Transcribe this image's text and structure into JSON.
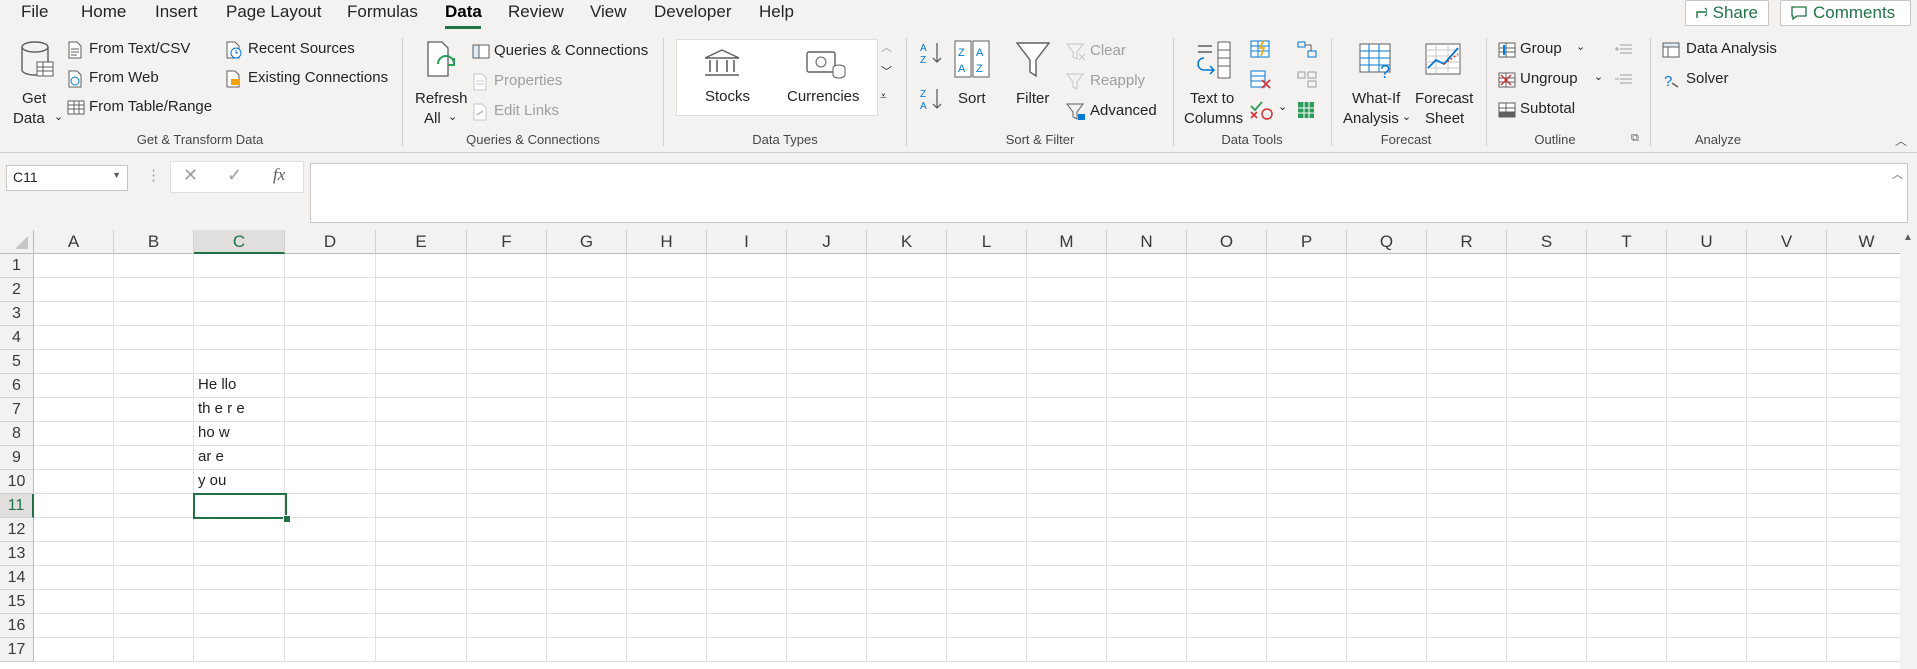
{
  "menu": {
    "items": [
      "File",
      "Home",
      "Insert",
      "Page Layout",
      "Formulas",
      "Data",
      "Review",
      "View",
      "Developer",
      "Help"
    ],
    "active": "Data",
    "share_label": "Share",
    "comments_label": "Comments"
  },
  "ribbon": {
    "get_transform": {
      "get_data_line1": "Get",
      "get_data_line2": "Data",
      "from_text_csv": "From Text/CSV",
      "from_web": "From Web",
      "from_table_range": "From Table/Range",
      "recent_sources": "Recent Sources",
      "existing_connections": "Existing Connections",
      "group_label": "Get & Transform Data"
    },
    "queries": {
      "refresh_line1": "Refresh",
      "refresh_line2": "All",
      "queries_connections": "Queries & Connections",
      "properties": "Properties",
      "edit_links": "Edit Links",
      "group_label": "Queries & Connections"
    },
    "data_types": {
      "stocks": "Stocks",
      "currencies": "Currencies",
      "group_label": "Data Types"
    },
    "sort_filter": {
      "sort": "Sort",
      "filter": "Filter",
      "clear": "Clear",
      "reapply": "Reapply",
      "advanced": "Advanced",
      "group_label": "Sort & Filter"
    },
    "data_tools": {
      "text_to_columns_line1": "Text to",
      "text_to_columns_line2": "Columns",
      "group_label": "Data Tools"
    },
    "forecast": {
      "what_if_line1": "What-If",
      "what_if_line2": "Analysis",
      "forecast_sheet_line1": "Forecast",
      "forecast_sheet_line2": "Sheet",
      "group_label": "Forecast"
    },
    "outline": {
      "group": "Group",
      "ungroup": "Ungroup",
      "subtotal": "Subtotal",
      "group_label": "Outline"
    },
    "analyze": {
      "data_analysis": "Data Analysis",
      "solver": "Solver",
      "group_label": "Analyze"
    }
  },
  "formula_bar": {
    "name_box": "C11",
    "cancel_glyph": "✕",
    "enter_glyph": "✓",
    "fx_glyph": "fx",
    "value": ""
  },
  "sheet": {
    "columns": [
      "A",
      "B",
      "C",
      "D",
      "E",
      "F",
      "G",
      "H",
      "I",
      "J",
      "K",
      "L",
      "M",
      "N",
      "O",
      "P",
      "Q",
      "R",
      "S",
      "T",
      "U",
      "V",
      "W"
    ],
    "rows": [
      "1",
      "2",
      "3",
      "4",
      "5",
      "6",
      "7",
      "8",
      "9",
      "10",
      "11",
      "12",
      "13",
      "14",
      "15",
      "16",
      "17"
    ],
    "selected_cell": "C11",
    "cells": {
      "C6": "He llo",
      "C7": "th e r e",
      "C8": "ho w",
      "C9": "ar e",
      "C10": "y ou"
    }
  }
}
